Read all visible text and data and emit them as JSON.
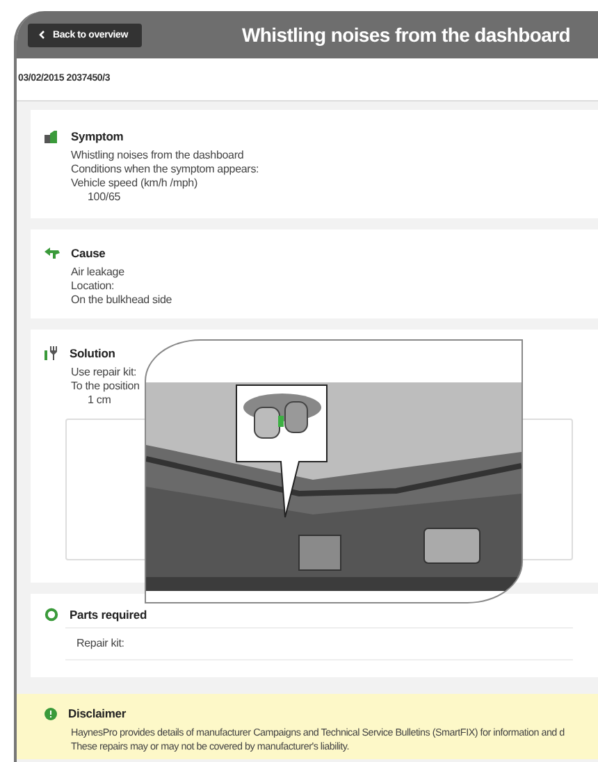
{
  "header": {
    "back_button": "Back to overview",
    "title": "Whistling noises from the dashboard"
  },
  "reference": "03/02/2015 2037450/3",
  "sections": [
    {
      "kind": "symptom",
      "title": "Symptom",
      "lines": [
        "Whistling noises from the dashboard",
        "Conditions when the symptom appears:",
        "Vehicle speed (km/h /mph)"
      ],
      "indented": [
        "100/65"
      ]
    },
    {
      "kind": "cause",
      "title": "Cause",
      "lines": [
        "Air leakage",
        "Location:",
        "On the bulkhead side"
      ]
    },
    {
      "kind": "solution",
      "title": "Solution",
      "lines": [
        "Use repair kit:",
        "To the position"
      ],
      "indented": [
        "1 cm"
      ]
    },
    {
      "kind": "parts",
      "title": "Parts required",
      "parts": [
        "Repair kit:"
      ]
    }
  ],
  "disclaimer": {
    "title": "Disclaimer",
    "lines": [
      "HaynesPro provides details of manufacturer Campaigns and Technical Service Bulletins (SmartFIX) for information and d",
      "These repairs may or may not be covered by manufacturer's liability."
    ]
  }
}
